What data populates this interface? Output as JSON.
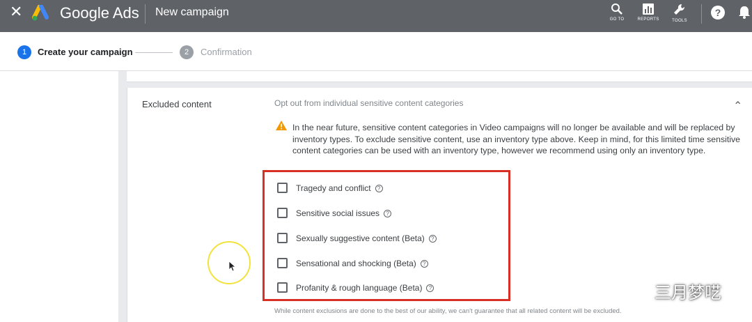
{
  "header": {
    "brand": "Google Ads",
    "title": "New campaign",
    "tools": [
      {
        "label": "GO TO",
        "icon": "search-icon"
      },
      {
        "label": "REPORTS",
        "icon": "reports-icon"
      },
      {
        "label": "TOOLS",
        "icon": "wrench-icon"
      }
    ],
    "help_icon": "?"
  },
  "stepper": {
    "steps": [
      {
        "number": "1",
        "label": "Create your campaign",
        "state": "active",
        "color": "#1a73e8"
      },
      {
        "number": "2",
        "label": "Confirmation",
        "state": "inactive",
        "color": "#9aa0a6"
      }
    ]
  },
  "section": {
    "label": "Excluded content",
    "subtitle": "Opt out from individual sensitive content categories",
    "warning": "In the near future, sensitive content categories in Video campaigns will no longer be available and will be replaced by inventory types. To exclude sensitive content, use an inventory type above. Keep in mind, for this limited time sensitive content categories can be used with an inventory type, however we recommend using only an inventory type.",
    "options": [
      {
        "label": "Tragedy and conflict",
        "checked": false
      },
      {
        "label": "Sensitive social issues",
        "checked": false
      },
      {
        "label": "Sexually suggestive content (Beta)",
        "checked": false
      },
      {
        "label": "Sensational and shocking (Beta)",
        "checked": false
      },
      {
        "label": "Profanity & rough language (Beta)",
        "checked": false
      }
    ],
    "footnote": "While content exclusions are done to the best of our ability, we can't guarantee that all related content will be excluded."
  },
  "watermark": {
    "text": "三月梦呓"
  },
  "colors": {
    "topbar": "#5f6368",
    "highlight": "#d93025",
    "warning": "#f29900",
    "cursor_ring": "#f1e23c"
  }
}
